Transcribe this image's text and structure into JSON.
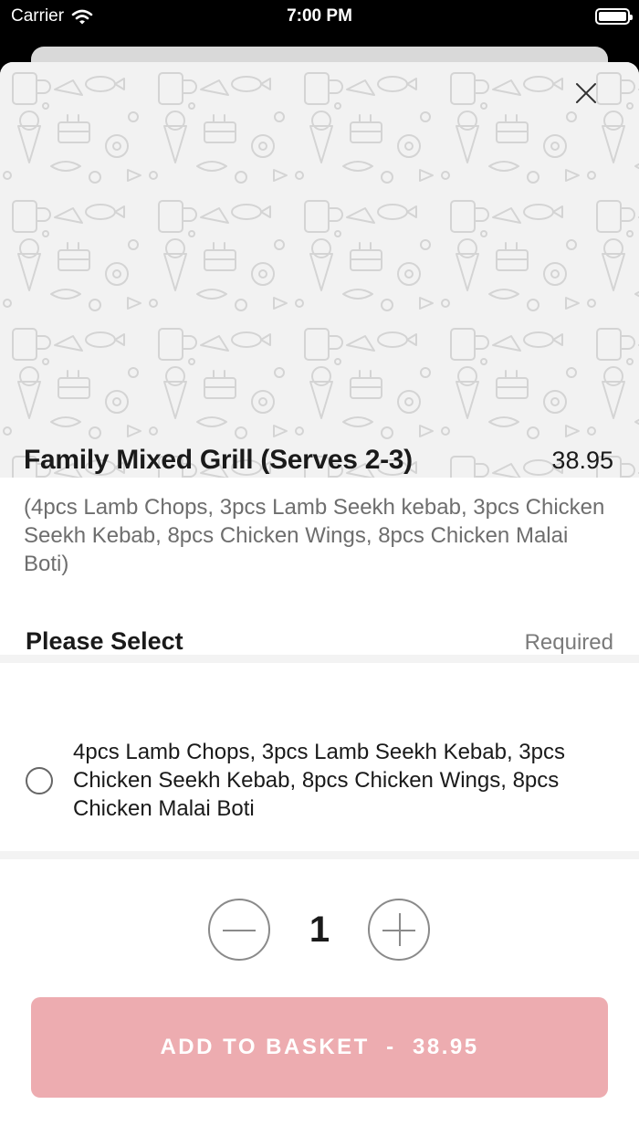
{
  "status_bar": {
    "carrier": "Carrier",
    "time": "7:00 PM"
  },
  "item": {
    "title": "Family Mixed Grill (Serves 2-3)",
    "price": "38.95",
    "description": "(4pcs Lamb Chops, 3pcs Lamb Seekh kebab, 3pcs Chicken Seekh Kebab, 8pcs Chicken Wings, 8pcs Chicken Malai Boti)"
  },
  "selection": {
    "title": "Please Select",
    "required_label": "Required",
    "options": [
      {
        "label": "4pcs Lamb Chops, 3pcs Lamb Seekh Kebab, 3pcs Chicken Seekh Kebab, 8pcs Chicken Wings, 8pcs Chicken Malai Boti",
        "selected": false
      }
    ]
  },
  "quantity": {
    "value": "1"
  },
  "add_button": {
    "label": "ADD TO BASKET  -  38.95"
  },
  "colors": {
    "accent": "#edacb0",
    "text": "#1a1a1a",
    "muted": "#6e6e6e"
  },
  "icons": [
    "wifi-icon",
    "battery-icon",
    "close-icon",
    "minus-icon",
    "plus-icon",
    "radio-icon"
  ]
}
